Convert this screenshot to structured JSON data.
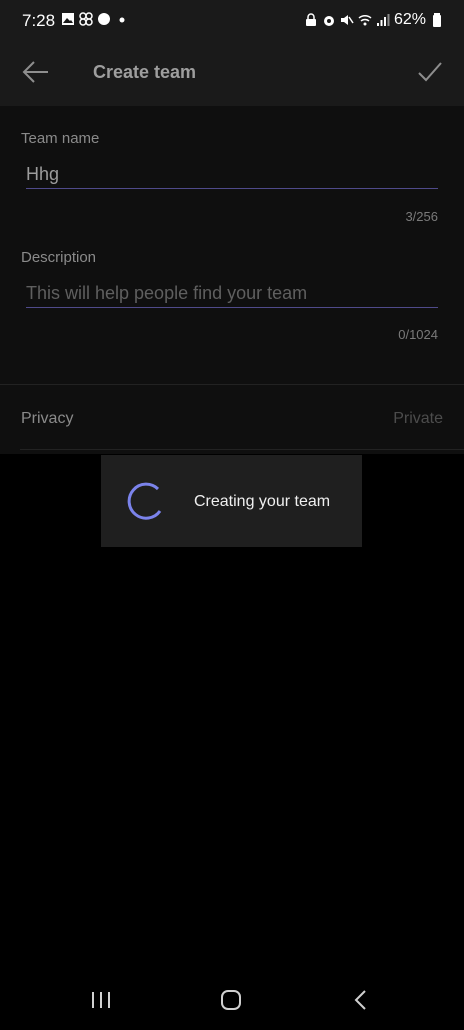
{
  "status_bar": {
    "time": "7:28",
    "battery": "62%"
  },
  "app_bar": {
    "title": "Create team"
  },
  "form": {
    "team_name": {
      "label": "Team name",
      "value": "Hhg",
      "counter": "3/256"
    },
    "description": {
      "label": "Description",
      "placeholder": "This will help people find your team",
      "counter": "0/1024"
    },
    "privacy": {
      "label": "Privacy",
      "value": "Private"
    }
  },
  "dialog": {
    "message": "Creating your team"
  },
  "colors": {
    "accent": "#7b83eb",
    "underline": "#4f4a8a"
  }
}
